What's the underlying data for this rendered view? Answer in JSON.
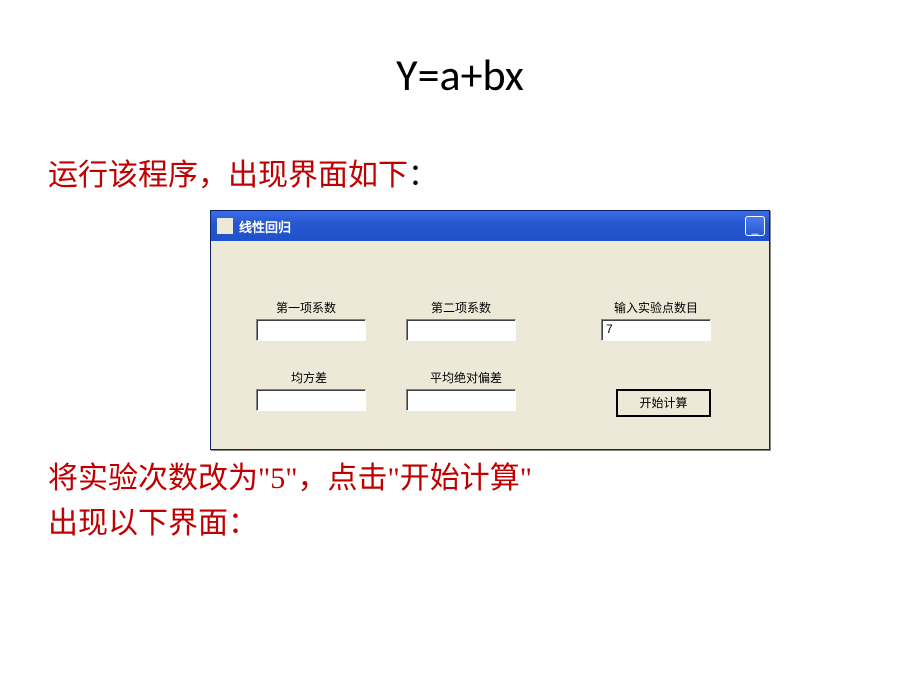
{
  "slide": {
    "title": "Y=a+bx",
    "intro": "运行该程序，出现界面如下",
    "intro_colon": "：",
    "outro_line1": "将实验次数改为\"5\"，点击\"开始计算\"",
    "outro_line2": "出现以下界面："
  },
  "window": {
    "title": "线性回归",
    "minimize_glyph": "_",
    "fields": {
      "coef1_label": "第一项系数",
      "coef1_value": "",
      "coef2_label": "第二项系数",
      "coef2_value": "",
      "npoints_label": "输入实验点数目",
      "npoints_value": "7",
      "msd_label": "均方差",
      "msd_value": "",
      "mabd_label": "平均绝对偏差",
      "mabd_value": ""
    },
    "button": {
      "label": "开始计算"
    }
  }
}
